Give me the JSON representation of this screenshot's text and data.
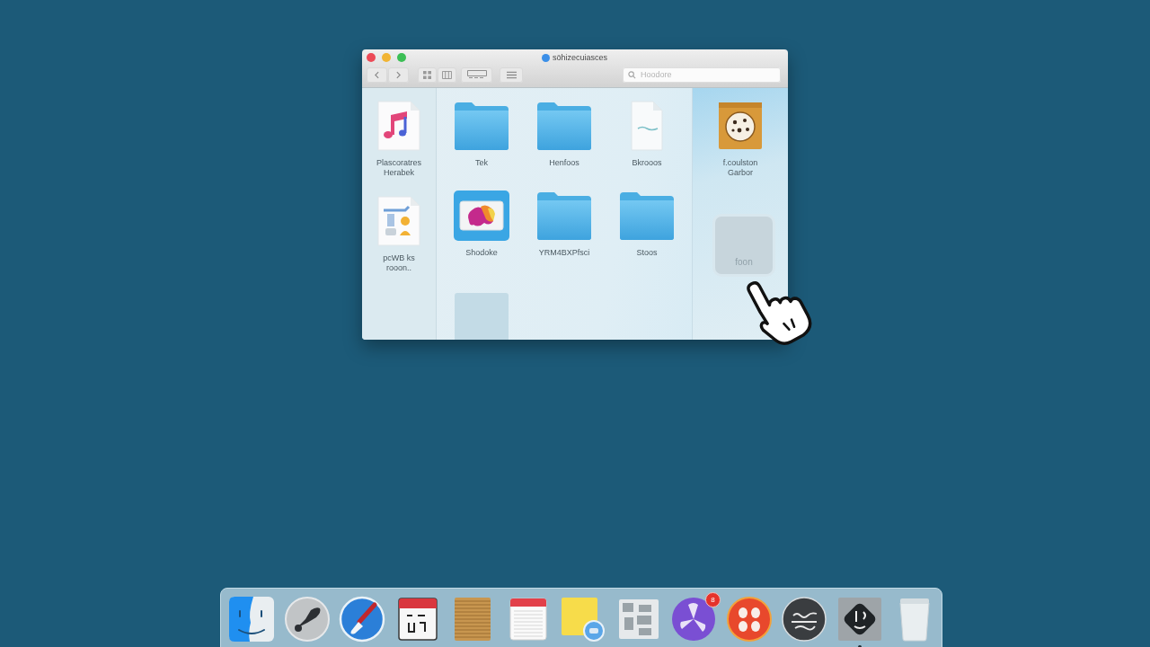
{
  "window": {
    "title": "söhizecuiasces",
    "search": {
      "placeholder": "Hoodore"
    }
  },
  "sidebar": {
    "items": [
      {
        "name": "Plascoratres Herabek",
        "kind": "music"
      },
      {
        "name": "pcWB ks rooon..",
        "kind": "installer"
      }
    ]
  },
  "files": [
    {
      "name": "Tek",
      "kind": "folder",
      "selected": false
    },
    {
      "name": "Henfoos",
      "kind": "folder",
      "selected": false
    },
    {
      "name": "Bkrooos",
      "kind": "document",
      "selected": false
    },
    {
      "name": "Shodoke",
      "kind": "app",
      "selected": true
    },
    {
      "name": "YRM4BXPfsci",
      "kind": "folder",
      "selected": false
    },
    {
      "name": "Stoos",
      "kind": "folder",
      "selected": false
    },
    {
      "kind": "blank",
      "selected": false
    }
  ],
  "preview": {
    "items": [
      {
        "name": "f.coulston Garbor",
        "kind": "image"
      },
      {
        "name": "foon",
        "kind": "ghost"
      }
    ]
  },
  "dock": {
    "apps": [
      {
        "kind": "finder",
        "running": false
      },
      {
        "kind": "rocket",
        "running": false
      },
      {
        "kind": "brush",
        "running": false
      },
      {
        "kind": "calendar",
        "running": false
      },
      {
        "kind": "notepad",
        "running": false
      },
      {
        "kind": "notes",
        "running": false
      },
      {
        "kind": "sticky",
        "running": false
      },
      {
        "kind": "collage",
        "running": false
      },
      {
        "kind": "propeller",
        "running": false,
        "badge": "8"
      },
      {
        "kind": "dots",
        "running": false
      },
      {
        "kind": "scribble",
        "running": false
      },
      {
        "kind": "diamond",
        "running": true
      },
      {
        "kind": "trash",
        "running": false
      }
    ]
  }
}
